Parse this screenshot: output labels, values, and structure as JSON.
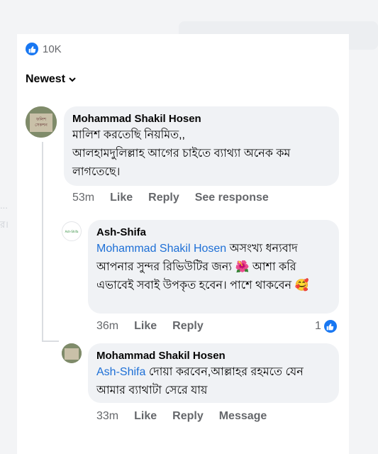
{
  "reactions": {
    "count": "10K"
  },
  "sort": {
    "label": "Newest"
  },
  "comments": [
    {
      "author": "Mohammad Shakil Hosen",
      "text": "মালিশ করতেছি নিয়মিত,,\nআলহামদুলিল্লাহ আগের চাইতে ব্যাথ্যা অনেক কম লাগতেছে।",
      "avatar_text": "ফলিশ\nসেকশন\nএর",
      "time": "53m",
      "like": "Like",
      "reply": "Reply",
      "extra": "See response"
    },
    {
      "author": "Ash-Shifa",
      "avatar_text": "Ash-Shifa",
      "mention": "Mohammad Shakil Hosen",
      "text": " অসংখ্য ধন্যবাদ আপনার সুন্দর রিভিউটির জন্য 🌺 আশা করি এভাবেই সবাই উপকৃত হবেন। পাশে থাকবেন 🥰",
      "time": "36m",
      "like": "Like",
      "reply": "Reply",
      "react_count": "1"
    },
    {
      "author": "Mohammad Shakil Hosen",
      "mention": "Ash-Shifa",
      "text": " দোয়া করবেন,আল্লাহর রহমতে যেন আমার ব্যাথাটা সেরে যায়",
      "time": "33m",
      "like": "Like",
      "reply": "Reply",
      "extra": "Message"
    }
  ],
  "colors": {
    "accent": "#1877f2",
    "bubble": "#f0f2f5",
    "mention": "#1d6fd6"
  },
  "icons": {
    "like": "thumbs-up-icon",
    "chevron": "chevron-down-icon"
  }
}
